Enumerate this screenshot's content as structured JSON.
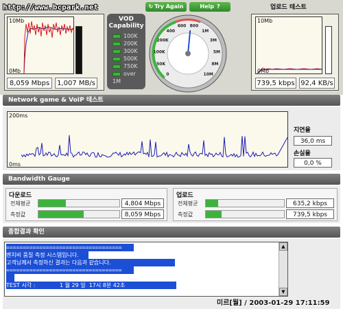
{
  "watermark": "http://www.bcpark.net",
  "download_chart": {
    "y_top": "10Mb",
    "y_bottom": "0Mb"
  },
  "download_readouts": [
    "8,059 Mbps",
    "1,007 MB/s"
  ],
  "vod": {
    "title_line1": "VOD",
    "title_line2": "Capability",
    "items": [
      "100K",
      "200K",
      "300K",
      "500K",
      "750K",
      "over 1M"
    ]
  },
  "buttons": {
    "try_again": "Try Again",
    "help": "Help"
  },
  "gauge": {
    "ticks": [
      "0",
      "50K",
      "100K",
      "200K",
      "400",
      "600",
      "800",
      "1M",
      "3M",
      "5M",
      "8M",
      "10M"
    ],
    "needle_fraction": 0.52
  },
  "upload": {
    "title": "업로드 테스트",
    "y_top": "10Mb",
    "y_bottom": "0Mb",
    "readouts": [
      "739,5 kbps",
      "92,4 KB/s"
    ]
  },
  "network": {
    "title": "Network game & VoIP 테스트",
    "y_top": "200ms",
    "y_bottom": "0ms",
    "latency_label": "지연율",
    "latency_value": "36,0 ms",
    "loss_label": "손실율",
    "loss_value": "0,0 %"
  },
  "bandwidth": {
    "title": "Bandwidth Gauge",
    "download": {
      "heading": "다운로드",
      "rows": [
        {
          "label": "전체평균",
          "value": "4,804 Mbps",
          "fill": 0.34
        },
        {
          "label": "측정값",
          "value": "8,059 Mbps",
          "fill": 0.56
        }
      ]
    },
    "upload": {
      "heading": "업로드",
      "rows": [
        {
          "label": "전체평균",
          "value": "635,2 kbps",
          "fill": 0.16
        },
        {
          "label": "측정값",
          "value": "739,5 kbps",
          "fill": 0.2
        }
      ]
    }
  },
  "summary": {
    "title": "종합결과 확인",
    "lines": [
      "===================================",
      "벤치비 품질 측정 시스템입니다.",
      "고객님께서 측정하신 결과는 다음과 같습니다.",
      "===================================",
      "",
      "TEST 시각 :              1 월 29 일  17시 8분 42초"
    ]
  },
  "footer_stamp": "미르[월]  /  2003-01-29 17:11:59"
}
